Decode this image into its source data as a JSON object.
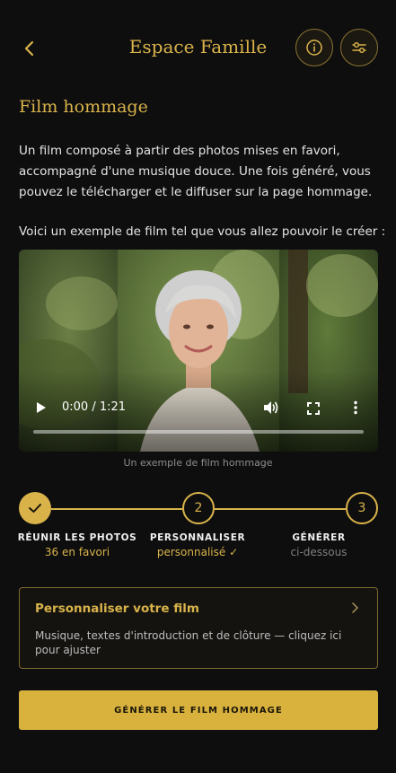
{
  "header": {
    "title": "Espace Famille",
    "back_icon": "chevron-left-icon",
    "info_icon": "info-icon",
    "settings_icon": "sliders-icon"
  },
  "section": {
    "title": "Film hommage",
    "description": "Un film composé à partir des photos mises en favori, accompagné d'une musique douce. Une fois généré, vous pouvez le télécharger et le diffuser sur la page hommage.",
    "example_text": "Voici un exemple de film tel que vous allez pouvoir le créer :"
  },
  "video": {
    "time": "0:00 / 1:21",
    "progress": 0,
    "caption": "Un exemple de film hommage"
  },
  "steps": [
    {
      "label": "RÉUNIR LES PHOTOS",
      "sub": "36 en favori",
      "state": "done"
    },
    {
      "number": "2",
      "label": "PERSONNALISER",
      "sub": "personnalisé ✓",
      "state": "active"
    },
    {
      "number": "3",
      "label": "GÉNÉRER",
      "sub": "ci-dessous",
      "state": "pending"
    }
  ],
  "customize_card": {
    "title": "Personnaliser votre film",
    "description": "Musique, textes d'introduction et de clôture — cliquez ici pour ajuster"
  },
  "generate_button": {
    "label": "GÉNÉRER LE FILM HOMMAGE"
  },
  "colors": {
    "background": "#0e0e0f",
    "accent": "#d9b34a",
    "muted": "#8d8d8d"
  }
}
